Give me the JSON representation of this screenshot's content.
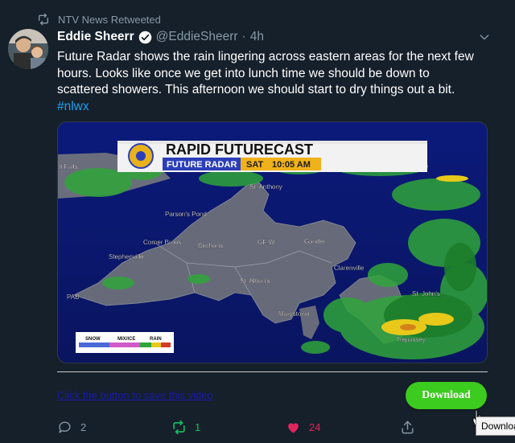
{
  "retweet": {
    "label": "NTV News Retweeted",
    "icon": "retweet-icon"
  },
  "author": {
    "name": "Eddie Sheerr",
    "handle": "@EddieSheerr",
    "separator": "·",
    "time": "4h",
    "verified": true
  },
  "tweet": {
    "text": "Future Radar shows the rain lingering across eastern areas for the next few hours. Looks like once we get into lunch time we should be down to scattered showers. This afternoon we should start to dry things out a bit.",
    "hashtag": "#nlwx"
  },
  "media": {
    "banner_title": "RAPID FUTURECAST",
    "banner_sub": "FUTURE RADAR",
    "banner_day": "SAT",
    "banner_time": "10:05 AM",
    "places": {
      "falls": "ll Falls",
      "st_anthony": "St. Anthony",
      "parsons_pond": "Parson's Pond",
      "corner_brook": "Corner Brook",
      "buchans": "Buchans",
      "gfw": "GF-W",
      "gander": "Gander",
      "stephenville": "Stephenville",
      "clarenville": "Clarenville",
      "st_albans": "St. Alban's",
      "pab": "PAB",
      "st_johns": "St. John's",
      "marystown": "Marystown",
      "trepassey": "Trepassey"
    },
    "legend": {
      "snow": "SNOW",
      "mix": "MIX/ICE",
      "rain": "RAIN"
    }
  },
  "download": {
    "link_text": "Click the button to save this video",
    "button_label": "Download",
    "tooltip": "Download"
  },
  "actions": {
    "replies": "2",
    "retweets": "1",
    "likes": "24"
  },
  "colors": {
    "background": "#15202b",
    "accent": "#1da1f2",
    "like": "#e0245e",
    "retweet": "#17bf63",
    "download": "#3ccb1f"
  }
}
